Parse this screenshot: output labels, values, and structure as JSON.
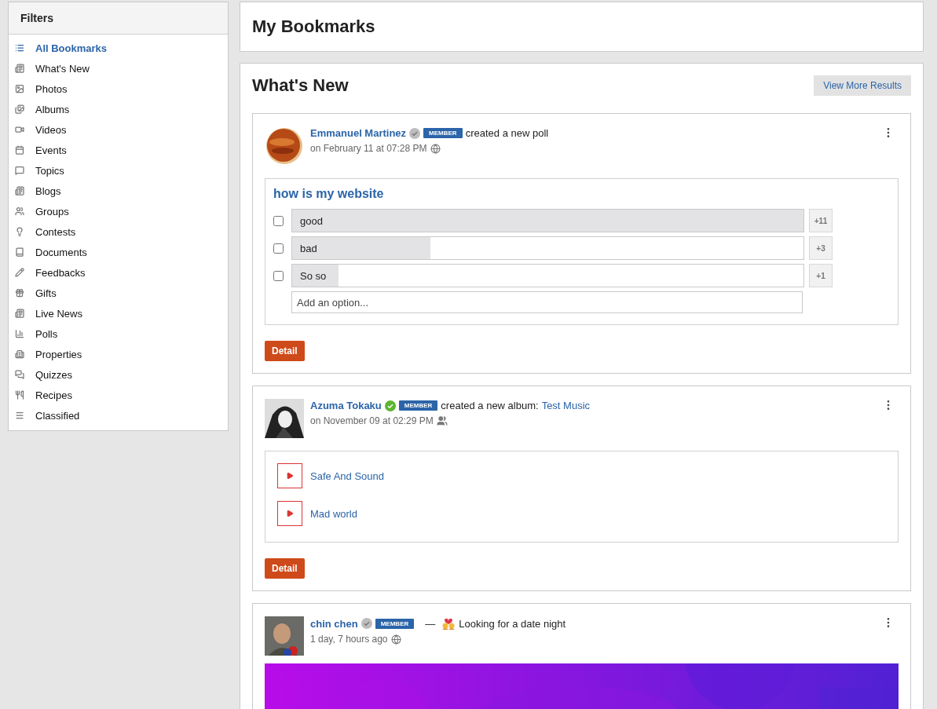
{
  "sidebar": {
    "title": "Filters",
    "items": [
      {
        "label": "All Bookmarks",
        "selected": true
      },
      {
        "label": "What's New",
        "selected": false
      },
      {
        "label": "Photos",
        "selected": false
      },
      {
        "label": "Albums",
        "selected": false
      },
      {
        "label": "Videos",
        "selected": false
      },
      {
        "label": "Events",
        "selected": false
      },
      {
        "label": "Topics",
        "selected": false
      },
      {
        "label": "Blogs",
        "selected": false
      },
      {
        "label": "Groups",
        "selected": false
      },
      {
        "label": "Contests",
        "selected": false
      },
      {
        "label": "Documents",
        "selected": false
      },
      {
        "label": "Feedbacks",
        "selected": false
      },
      {
        "label": "Gifts",
        "selected": false
      },
      {
        "label": "Live News",
        "selected": false
      },
      {
        "label": "Polls",
        "selected": false
      },
      {
        "label": "Properties",
        "selected": false
      },
      {
        "label": "Quizzes",
        "selected": false
      },
      {
        "label": "Recipes",
        "selected": false
      },
      {
        "label": "Classified",
        "selected": false
      }
    ]
  },
  "page_title": "My Bookmarks",
  "section": {
    "title": "What's New",
    "button": "View More Results"
  },
  "feed": [
    {
      "kind": "poll",
      "author": "Emmanuel Martinez",
      "verified": false,
      "badge": "MEMBER",
      "action": "created a new poll",
      "time": "on February 11 at 07:28 PM",
      "privacy": {
        "kind": "public"
      },
      "poll": {
        "question": "how is my website",
        "options": [
          {
            "label": "good",
            "checked": false,
            "level": 1.0,
            "count": "+11"
          },
          {
            "label": "bad",
            "checked": false,
            "level": 0.27,
            "count": "+3"
          },
          {
            "label": "So so",
            "checked": false,
            "level": 0.09,
            "count": "+1"
          }
        ],
        "add_placeholder": "Add an option..."
      },
      "button": "Detail"
    },
    {
      "kind": "album",
      "author": "Azuma Tokaku",
      "verified": true,
      "badge": "MEMBER",
      "action": "created a new album:",
      "target": "Test Music",
      "time": "on November 09 at 02:29 PM",
      "privacy": {
        "kind": "friends"
      },
      "tracks": [
        "Safe And Sound",
        "Mad world"
      ],
      "button": "Detail"
    },
    {
      "kind": "status",
      "author": "chin chen",
      "verified": false,
      "badge": "MEMBER",
      "dash": "—",
      "action": "Looking for a date night",
      "time": "1 day, 7 hours ago",
      "privacy": {
        "kind": "public"
      }
    }
  ]
}
